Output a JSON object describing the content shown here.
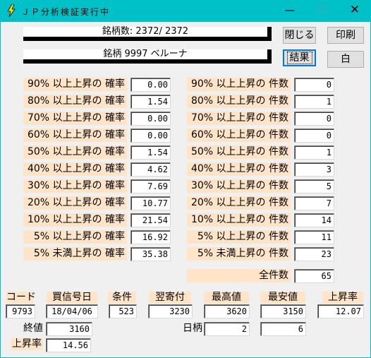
{
  "window": {
    "title": "ＪＰ分析検証実行中",
    "minimize_glyph": "—",
    "maximize_glyph": "☐",
    "close_glyph": "✕"
  },
  "progress": {
    "count_label": "銘柄数: 2372/ 2372",
    "count_fraction": 1.0,
    "current_label": "銘柄 9997 ベルーナ",
    "current_fraction": 1.0
  },
  "buttons": {
    "close_label": "閉じる",
    "print_label": "印刷",
    "result_label": "結果",
    "white_label": "白"
  },
  "probabilities": [
    {
      "label": "90% 以上上昇の 確率",
      "value": "0.00"
    },
    {
      "label": "80% 以上上昇の 確率",
      "value": "1.54"
    },
    {
      "label": "70% 以上上昇の 確率",
      "value": "0.00"
    },
    {
      "label": "60% 以上上昇の 確率",
      "value": "0.00"
    },
    {
      "label": "50% 以上上昇の 確率",
      "value": "1.54"
    },
    {
      "label": "40% 以上上昇の 確率",
      "value": "4.62"
    },
    {
      "label": "30% 以上上昇の 確率",
      "value": "7.69"
    },
    {
      "label": "20% 以上上昇の 確率",
      "value": "10.77"
    },
    {
      "label": "10% 以上上昇の 確率",
      "value": "21.54"
    },
    {
      "label": "5% 以上上昇の 確率",
      "value": "16.92"
    },
    {
      "label": "5% 未満上昇の 確率",
      "value": "35.38"
    }
  ],
  "counts": [
    {
      "label": "90% 以上上昇の 件数",
      "value": "0"
    },
    {
      "label": "80% 以上上昇の 件数",
      "value": "1"
    },
    {
      "label": "70% 以上上昇の 件数",
      "value": "0"
    },
    {
      "label": "60% 以上上昇の 件数",
      "value": "0"
    },
    {
      "label": "50% 以上上昇の 件数",
      "value": "1"
    },
    {
      "label": "40% 以上上昇の 件数",
      "value": "3"
    },
    {
      "label": "30% 以上上昇の 件数",
      "value": "5"
    },
    {
      "label": "20% 以上上昇の 件数",
      "value": "7"
    },
    {
      "label": "10% 以上上昇の 件数",
      "value": "14"
    },
    {
      "label": "5% 以上上昇の 件数",
      "value": "11"
    },
    {
      "label": "5% 未満上昇の 件数",
      "value": "23"
    }
  ],
  "total": {
    "label": "全件数",
    "value": "65"
  },
  "detail": {
    "code_label": "コード",
    "code": "9793",
    "signal_date_label": "買信号日",
    "signal_date": "18/04/06",
    "condition_label": "条件",
    "condition": "523",
    "next_open_label": "翌寄付",
    "next_open": "3230",
    "high_label": "最高値",
    "high": "3620",
    "low_label": "最安値",
    "low": "3150",
    "rise_rate_label": "上昇率",
    "rise_rate": "12.07",
    "close_label": "終値",
    "close": "3160",
    "days_label": "日柄",
    "days_high": "2",
    "days_low": "6",
    "close_rise_label": "上昇率",
    "close_rise": "14.56"
  },
  "colors": {
    "titlebar": "#00c0c8",
    "label_bg": "#ffe4c8",
    "client_bg": "#f0f0f0"
  }
}
